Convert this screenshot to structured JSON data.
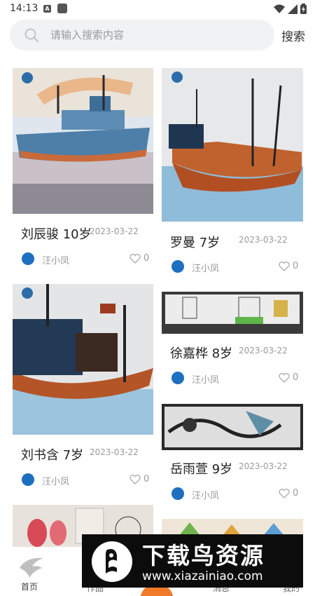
{
  "status_bar": {
    "time": "14:13",
    "a_badge": "A"
  },
  "search": {
    "placeholder": "请输入搜索内容",
    "button_label": "搜索"
  },
  "cards": [
    {
      "title": "刘辰骏 10岁",
      "date": "2023-03-22",
      "author": "汪小凤",
      "likes": "0"
    },
    {
      "title": "罗曼 7岁",
      "date": "2023-03-22",
      "author": "汪小凤",
      "likes": "0"
    },
    {
      "title": "徐嘉桦 8岁",
      "date": "2023-03-22",
      "author": "汪小凤",
      "likes": "0"
    },
    {
      "title": "刘书含 7岁",
      "date": "2023-03-22",
      "author": "汪小凤",
      "likes": "0"
    },
    {
      "title": "岳雨萱 9岁",
      "date": "2023-03-22",
      "author": "汪小凤",
      "likes": "0"
    }
  ],
  "nav": {
    "home_label": "首页",
    "tab2_label": "作品",
    "tab3_label": "消息",
    "tab4_label": "我的"
  },
  "watermark": {
    "title": "下载鸟资源",
    "url": "www.xiazainiao.com"
  },
  "colors": {
    "accent": "#1e6fc0",
    "search_bg": "#f1f2f4",
    "muted_text": "#9a9a9a"
  }
}
